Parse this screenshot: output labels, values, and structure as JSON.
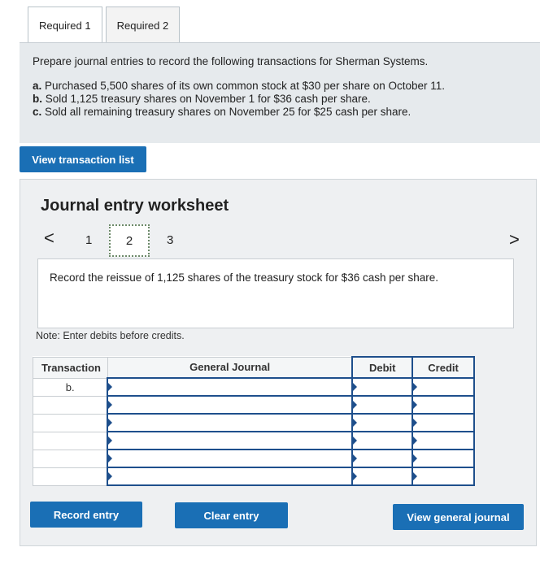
{
  "tabs": [
    {
      "label": "Required 1"
    },
    {
      "label": "Required 2"
    }
  ],
  "question": {
    "intro": "Prepare journal entries to record the following transactions for Sherman Systems.",
    "items": [
      {
        "letter": "a.",
        "text": " Purchased 5,500 shares of its own common stock at $30 per share on October 11."
      },
      {
        "letter": "b.",
        "text": " Sold 1,125 treasury shares on November 1 for $36 cash per share."
      },
      {
        "letter": "c.",
        "text": " Sold all remaining treasury shares on November 25 for $25 cash per share."
      }
    ]
  },
  "buttons": {
    "view_transactions": "View transaction list",
    "record_entry": "Record entry",
    "clear_entry": "Clear entry",
    "view_general_journal": "View general journal"
  },
  "worksheet": {
    "title": "Journal entry worksheet",
    "prev": "<",
    "next": ">",
    "pages": [
      "1",
      "2",
      "3"
    ],
    "current_page": "2",
    "instruction": "Record the reissue of 1,125 shares of the treasury stock for $36 cash per share.",
    "note": "Note: Enter debits before credits."
  },
  "table": {
    "headers": {
      "transaction": "Transaction",
      "general_journal": "General Journal",
      "debit": "Debit",
      "credit": "Credit"
    },
    "rows": [
      {
        "transaction": "b."
      },
      {
        "transaction": ""
      },
      {
        "transaction": ""
      },
      {
        "transaction": ""
      },
      {
        "transaction": ""
      },
      {
        "transaction": ""
      }
    ]
  },
  "colors": {
    "button_blue": "#1a6fb5",
    "table_border_blue": "#1e4f8c",
    "question_bg": "#e6eaed"
  }
}
